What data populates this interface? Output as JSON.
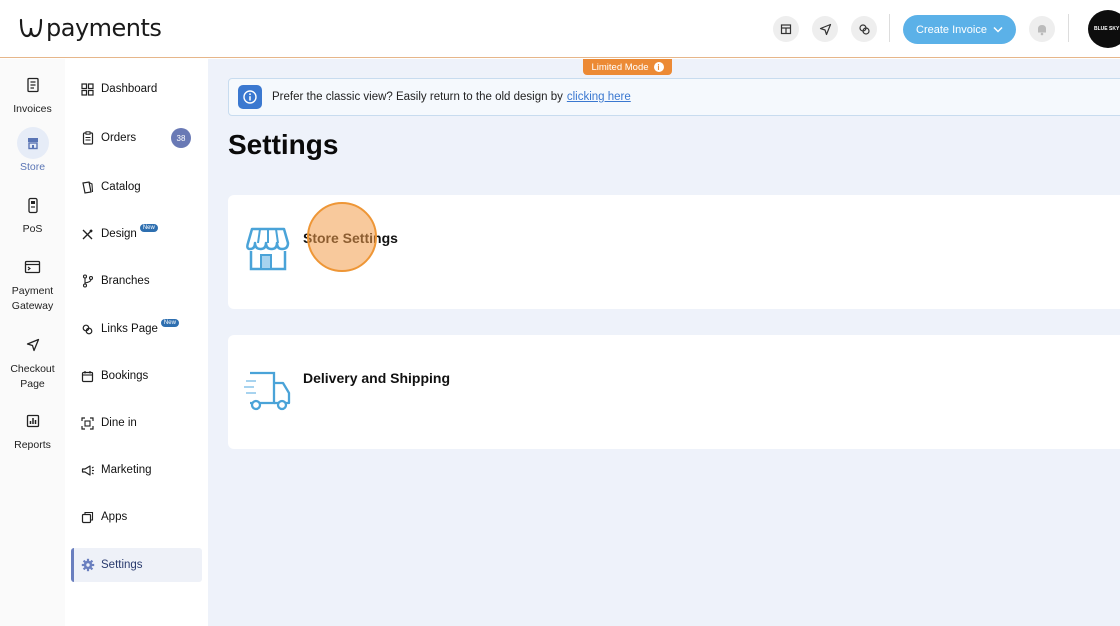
{
  "header": {
    "logo_text": "payments",
    "create_invoice_label": "Create Invoice",
    "avatar_text": "BLUE SKY",
    "limited_mode_label": "Limited Mode"
  },
  "rail": {
    "items": [
      {
        "label": "Invoices",
        "icon": "invoice-icon"
      },
      {
        "label": "Store",
        "icon": "store-icon",
        "active": true
      },
      {
        "label": "PoS",
        "icon": "pos-icon"
      },
      {
        "label": "Payment Gateway",
        "icon": "payment-gateway-icon"
      },
      {
        "label": "Checkout Page",
        "icon": "checkout-icon"
      },
      {
        "label": "Reports",
        "icon": "reports-icon"
      }
    ]
  },
  "nav": {
    "items": [
      {
        "label": "Dashboard",
        "icon": "dashboard-icon"
      },
      {
        "label": "Orders",
        "icon": "orders-icon",
        "count": "38"
      },
      {
        "label": "Catalog",
        "icon": "catalog-icon"
      },
      {
        "label": "Design",
        "icon": "design-icon",
        "badge": "New"
      },
      {
        "label": "Branches",
        "icon": "branches-icon"
      },
      {
        "label": "Links Page",
        "icon": "links-icon",
        "badge": "New"
      },
      {
        "label": "Bookings",
        "icon": "calendar-icon"
      },
      {
        "label": "Dine in",
        "icon": "qr-icon"
      },
      {
        "label": "Marketing",
        "icon": "megaphone-icon"
      },
      {
        "label": "Apps",
        "icon": "apps-icon"
      },
      {
        "label": "Settings",
        "icon": "gear-icon",
        "active": true
      }
    ]
  },
  "banner": {
    "text": "Prefer the classic view? Easily return to the old design by",
    "link": "clicking here"
  },
  "main": {
    "title": "Settings",
    "cards": [
      {
        "title": "Store Settings",
        "icon": "storefront-icon"
      },
      {
        "title": "Delivery and Shipping",
        "icon": "delivery-truck-icon"
      }
    ]
  },
  "colors": {
    "accent": "#5bb1e8",
    "limited_badge": "#ec8a35",
    "main_bg": "#eef2fa",
    "nav_active": "#6a7fbf"
  }
}
